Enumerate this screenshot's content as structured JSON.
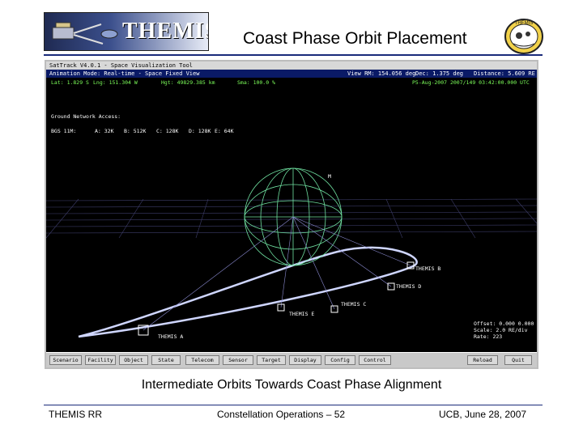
{
  "header": {
    "logo_text": "THEMIS",
    "title": "Coast Phase Orbit Placement",
    "patch_text": "THEMIS"
  },
  "app": {
    "titlebar": "SatTrack V4.0.1 - Space Visualization Tool",
    "menubar": {
      "animation_mode": "Animation Mode: Real-time - Space Fixed View",
      "view_rm": "View RM: 154.056 deg",
      "dec": "Dec: 1.375 deg",
      "distance": "Distance: 5.609 RE"
    },
    "status": {
      "lat": "Lat: 1.829 S",
      "lng": "Lng: 151.304 W",
      "hgt": "Hgt: 49829.385 km",
      "sma": "Sma: 100.0 %",
      "epoch": "P5-Aug-2007 2007/149 03:42:00.000 UTC"
    },
    "ground_network_heading": "Ground Network Access:",
    "ground_network": {
      "station": "BGS 11M:",
      "a": "A: 32K",
      "b": "B: 512K",
      "c": "C: 128K",
      "d": "D: 128K",
      "e": "E: 64K"
    },
    "sat_labels": {
      "b": "THEMIS B",
      "d": "THEMIS D",
      "c": "THEMIS C",
      "e": "THEMIS E",
      "a": "THEMIS A"
    },
    "earth_marker": "M",
    "view_info": {
      "offset": "Offset: 0.000 0.000",
      "scale": "Scale: 2.0 RE/div",
      "rate": "Rate: 223"
    },
    "toolbar": {
      "scenario": "Scenario",
      "facility": "Facility",
      "object": "Object",
      "state": "State",
      "telecom": "Telecom",
      "sensor": "Sensor",
      "target": "Target",
      "display": "Display",
      "config": "Config",
      "control": "Control",
      "reload": "Reload",
      "quit": "Quit"
    }
  },
  "caption": "Intermediate Orbits Towards Coast Phase Alignment",
  "footer": {
    "left": "THEMIS RR",
    "center": "Constellation Operations – 52",
    "right": "UCB, June 28, 2007"
  },
  "colors": {
    "title_rule": "#1a2a7a",
    "status_text": "#7dff5a",
    "earth_wireframe": "#6fe0a0",
    "orbit": "#cfd6ff",
    "menubar": "#0a1a66"
  }
}
